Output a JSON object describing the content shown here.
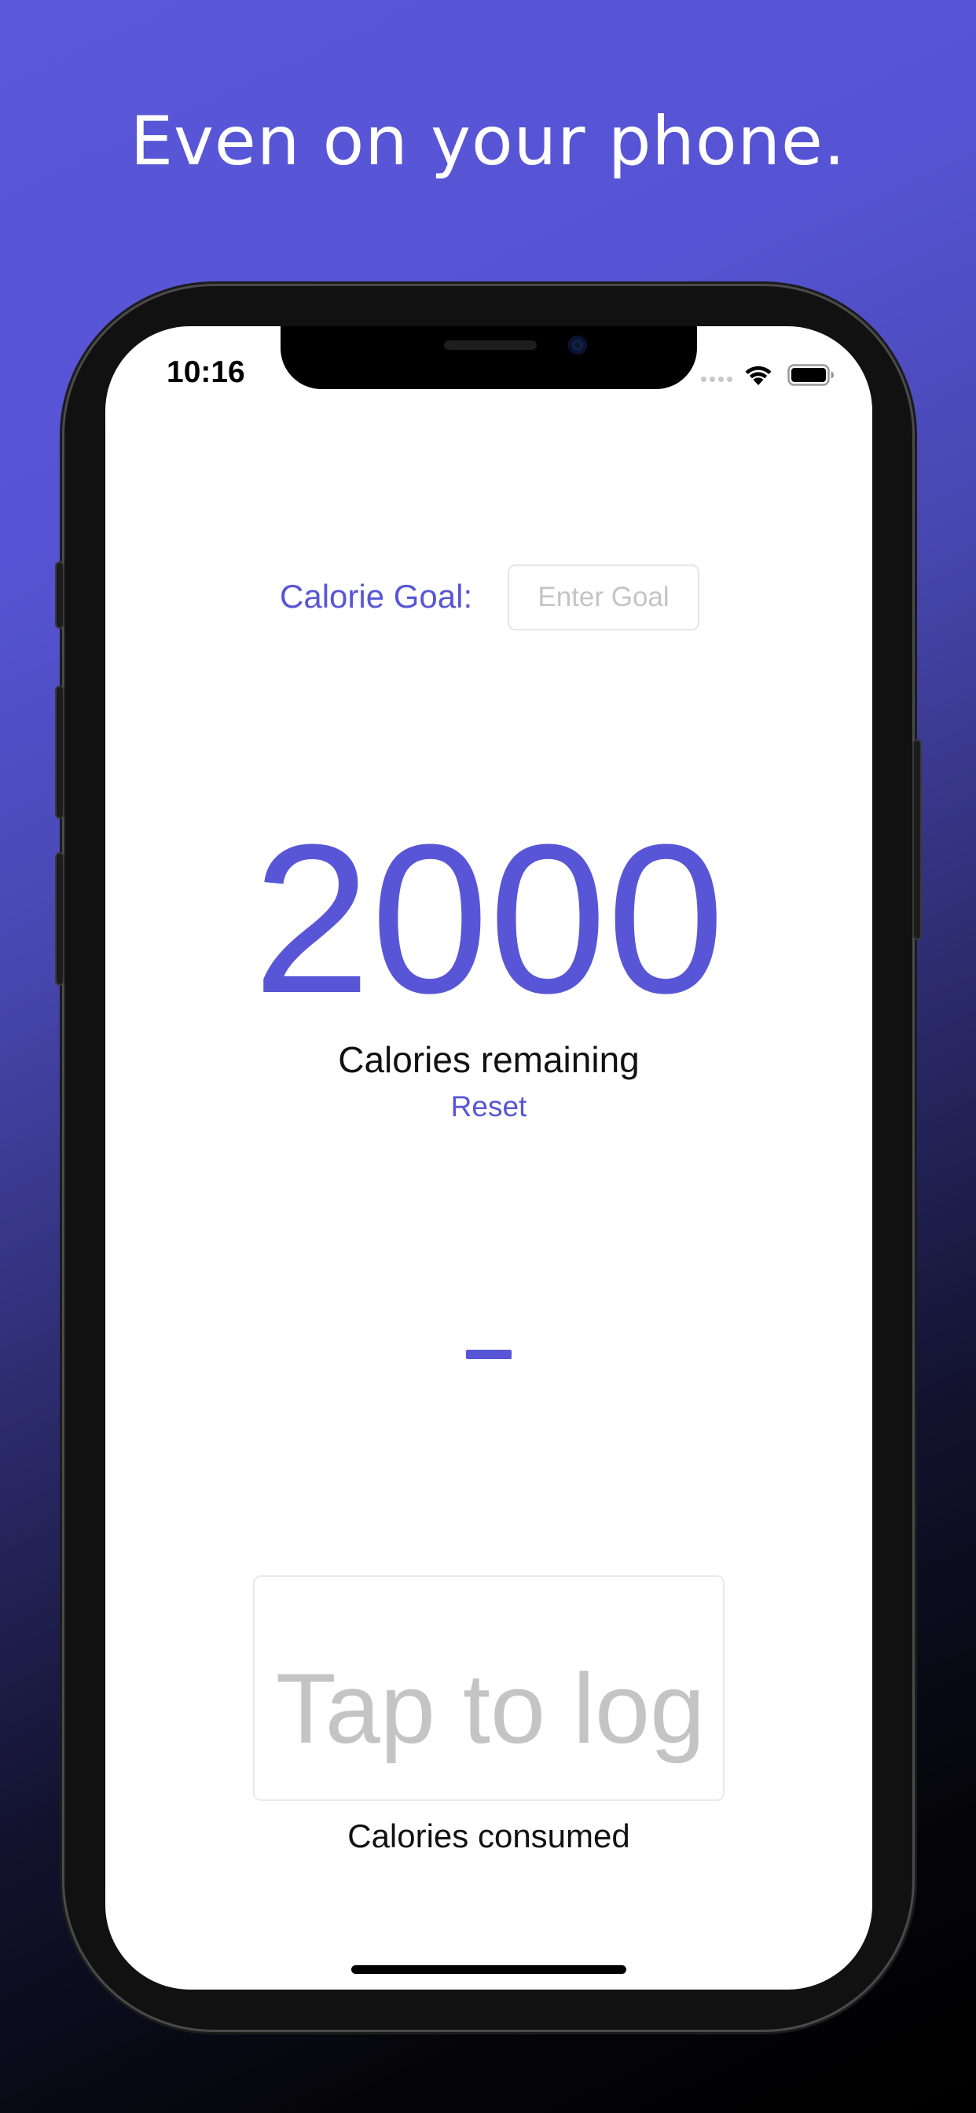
{
  "headline": "Even on your phone.",
  "status_bar": {
    "time": "10:16"
  },
  "goal": {
    "label": "Calorie Goal:",
    "placeholder": "Enter Goal",
    "value": ""
  },
  "remaining": {
    "value": "2000",
    "label": "Calories remaining",
    "reset_label": "Reset"
  },
  "operator_symbol": "minus",
  "log": {
    "placeholder": "Tap to log",
    "label": "Calories consumed"
  },
  "colors": {
    "accent": "#5856d6",
    "placeholder": "#c4c4c4",
    "background_top": "#5a57d9",
    "background_bottom": "#000000"
  },
  "icons": [
    "signal-dots-icon",
    "wifi-icon",
    "battery-icon"
  ]
}
